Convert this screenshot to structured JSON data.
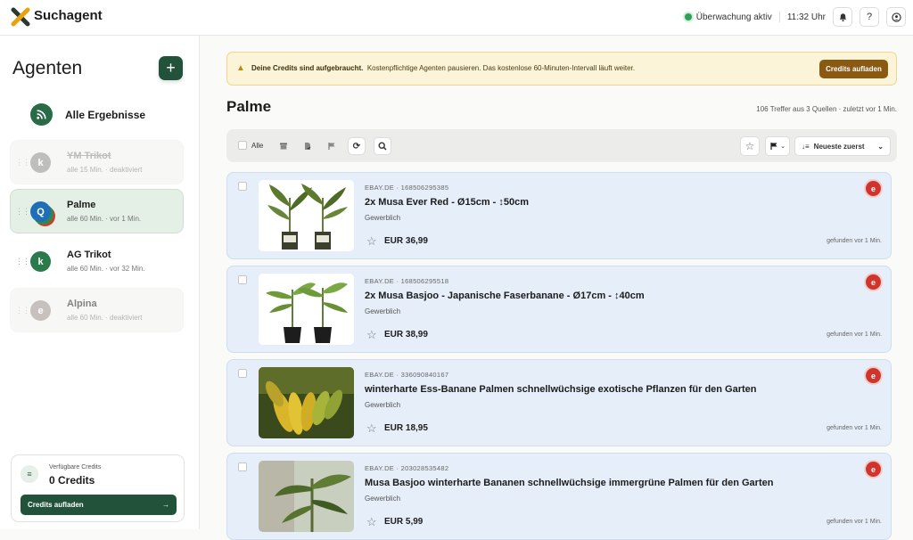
{
  "app": {
    "brand": "Suchagent"
  },
  "topbar": {
    "status": "Überwachung aktiv",
    "time": "11:32 Uhr",
    "icons": [
      "bell-icon",
      "help-icon",
      "user-icon"
    ]
  },
  "sidebar": {
    "title": "Agenten",
    "all_results": "Alle Ergebnisse",
    "agents": [
      {
        "initial": "k",
        "name": "YM Trikot",
        "meta": "alle 15 Min. · deaktiviert",
        "color": "#8a8a86",
        "state": "deactivated"
      },
      {
        "initial": "Q",
        "name": "Palme",
        "meta": "alle 60 Min. · vor 1 Min.",
        "color": "#1f6fb8",
        "state": "active"
      },
      {
        "initial": "k",
        "name": "AG Trikot",
        "meta": "alle 60 Min. · vor 32 Min.",
        "color": "#2a7a4b",
        "state": "normal"
      },
      {
        "initial": "e",
        "name": "Alpina",
        "meta": "alle 60 Min. · deaktiviert",
        "color": "#9a8f88",
        "state": "deactivated"
      }
    ],
    "credits": {
      "label": "Verfügbare Credits",
      "value": "0 Credits",
      "button": "Credits aufladen"
    }
  },
  "banner": {
    "bold": "Deine Credits sind aufgebraucht.",
    "text": "Kostenpflichtige Agenten pausieren. Das kostenlose 60-Minuten-Intervall läuft weiter.",
    "button": "Credits aufladen"
  },
  "main": {
    "title": "Palme",
    "summary": "106 Treffer aus 3 Quellen · zuletzt vor 1 Min.",
    "toolbar": {
      "select_all": "Alle",
      "sort": "Neueste zuerst"
    },
    "results": [
      {
        "source": "EBAY.DE · 168506295385",
        "title": "2x Musa Ever Red - Ø15cm - ↕50cm",
        "seller": "Gewerblich",
        "price": "EUR 36,99",
        "found": "gefunden vor 1 Min.",
        "thumb": "plant"
      },
      {
        "source": "EBAY.DE · 168506295518",
        "title": "2x Musa Basjoo - Japanische Faserbanane - Ø17cm - ↕40cm",
        "seller": "Gewerblich",
        "price": "EUR 38,99",
        "found": "gefunden vor 1 Min.",
        "thumb": "plant-pots"
      },
      {
        "source": "EBAY.DE · 336090840167",
        "title": "winterharte Ess-Banane Palmen schnellwüchsige exotische Pflanzen für den Garten",
        "seller": "Gewerblich",
        "price": "EUR 18,95",
        "found": "gefunden vor 1 Min.",
        "thumb": "bananas"
      },
      {
        "source": "EBAY.DE · 203028535482",
        "title": "Musa Basjoo winterharte Bananen schnellwüchsige immergrüne Palmen für den Garten",
        "seller": "Gewerblich",
        "price": "EUR 5,99",
        "found": "gefunden vor 1 Min.",
        "thumb": "garden"
      }
    ]
  }
}
